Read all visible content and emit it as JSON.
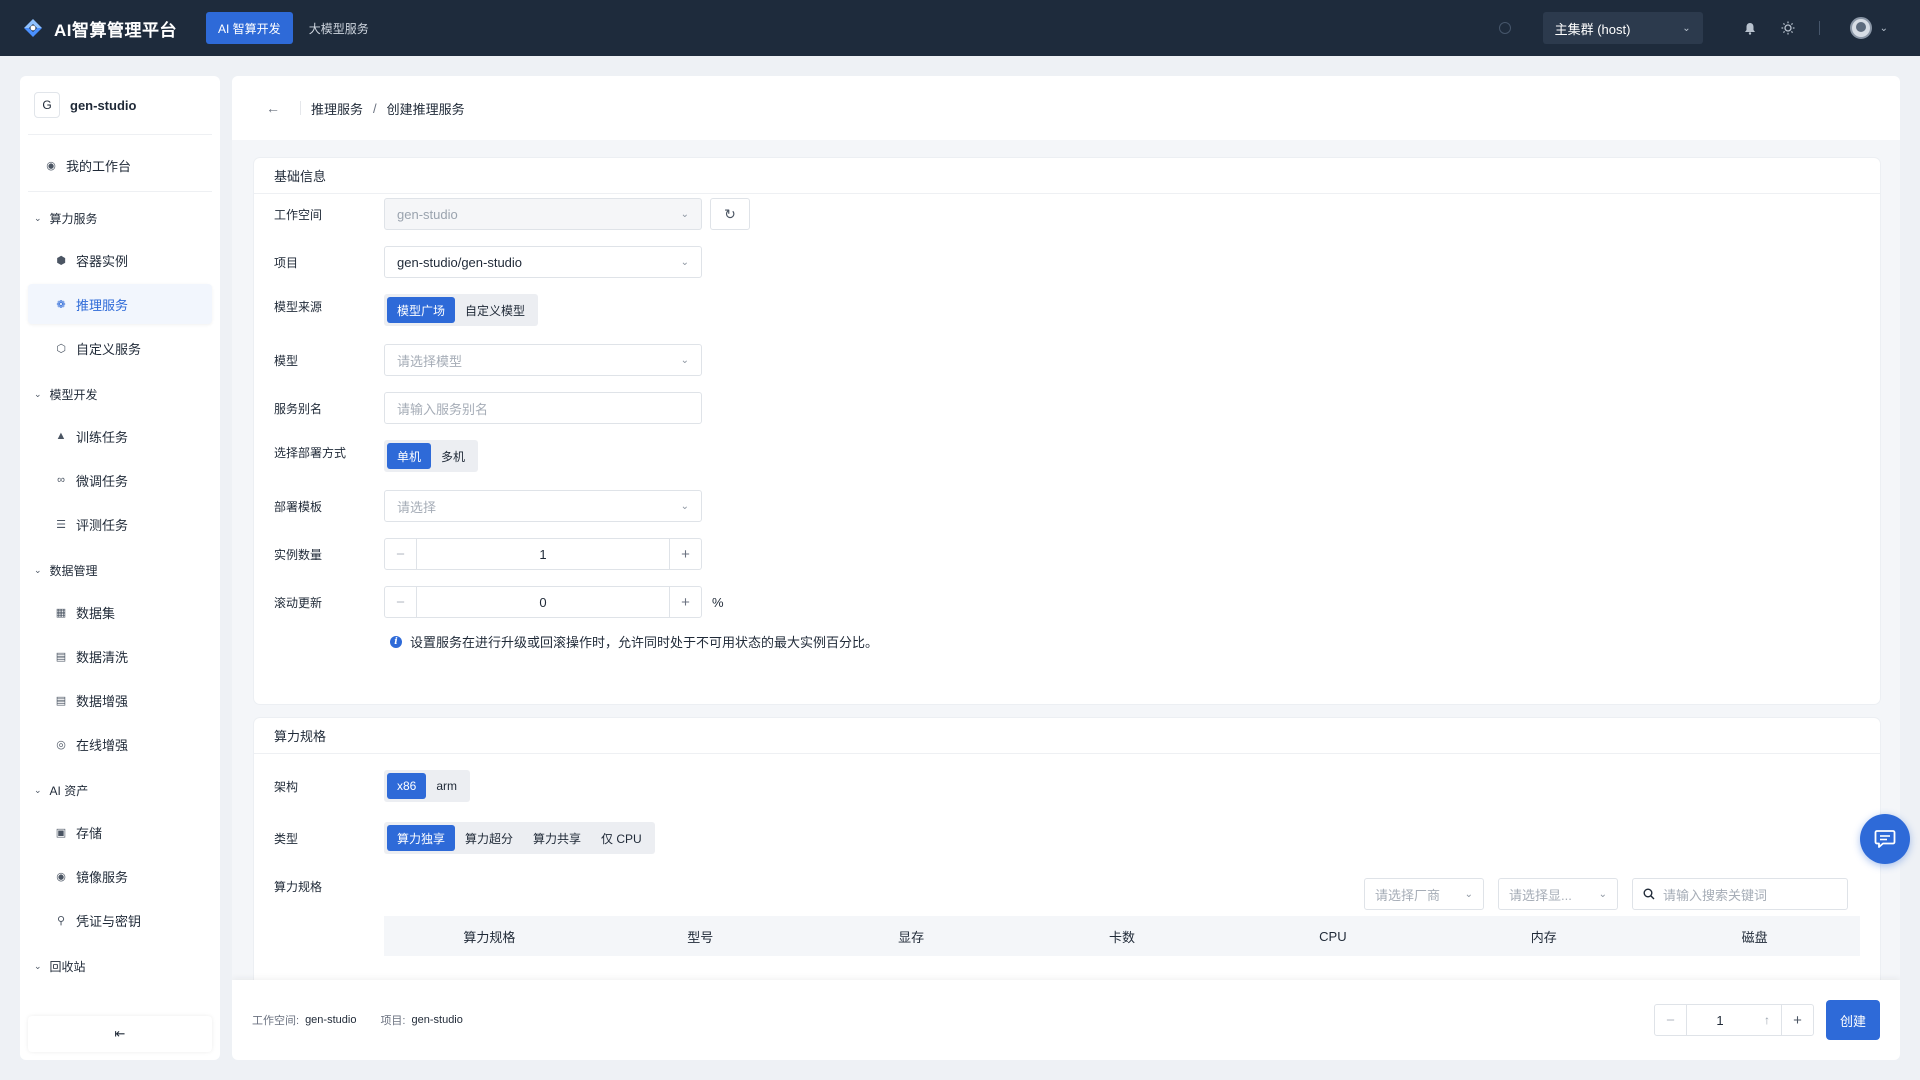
{
  "app": {
    "title": "AI智算管理平台",
    "nav_tabs": [
      {
        "label": "AI 智算开发",
        "active": true
      },
      {
        "label": "大模型服务",
        "active": false
      }
    ],
    "cluster": "主集群 (host)"
  },
  "sidebar": {
    "workspace_badge": "G",
    "workspace_name": "gen-studio",
    "workbench": "我的工作台",
    "groups": [
      {
        "title": "算力服务",
        "items": [
          "容器实例",
          "推理服务",
          "自定义服务"
        ]
      },
      {
        "title": "模型开发",
        "items": [
          "训练任务",
          "微调任务",
          "评测任务"
        ]
      },
      {
        "title": "数据管理",
        "items": [
          "数据集",
          "数据清洗",
          "数据增强",
          "在线增强"
        ]
      },
      {
        "title": "AI 资产",
        "items": [
          "存储",
          "镜像服务",
          "凭证与密钥"
        ]
      },
      {
        "title": "回收站",
        "items": []
      }
    ],
    "active_item": "推理服务",
    "collapse_icon": "⇤"
  },
  "breadcrumb": {
    "parent": "推理服务",
    "sep": "/",
    "current": "创建推理服务"
  },
  "basic": {
    "title": "基础信息",
    "workspace_label": "工作空间",
    "workspace_value": "gen-studio",
    "project_label": "项目",
    "project_value": "gen-studio/gen-studio",
    "source_label": "模型来源",
    "source_options": [
      "模型广场",
      "自定义模型"
    ],
    "model_label": "模型",
    "model_placeholder": "请选择模型",
    "alias_label": "服务别名",
    "alias_placeholder": "请输入服务别名",
    "deploy_label": "选择部署方式",
    "deploy_options": [
      "单机",
      "多机"
    ],
    "template_label": "部署模板",
    "template_placeholder": "请选择",
    "instances_label": "实例数量",
    "instances_value": "1",
    "rolling_label": "滚动更新",
    "rolling_value": "0",
    "rolling_unit": "%",
    "rolling_hint": "设置服务在进行升级或回滚操作时，允许同时处于不可用状态的最大实例百分比。"
  },
  "compute": {
    "title": "算力规格",
    "arch_label": "架构",
    "arch_options": [
      "x86",
      "arm"
    ],
    "type_label": "类型",
    "type_options": [
      "算力独享",
      "算力超分",
      "算力共享",
      "仅 CPU"
    ],
    "spec_label": "算力规格",
    "vendor_placeholder": "请选择厂商",
    "memory_placeholder": "请选择显...",
    "search_placeholder": "请输入搜索关键词",
    "columns": [
      "算力规格",
      "型号",
      "显存",
      "卡数",
      "CPU",
      "内存",
      "磁盘"
    ]
  },
  "footer": {
    "workspace_label": "工作空间:",
    "workspace_value": "gen-studio",
    "project_label": "项目:",
    "project_value": "gen-studio",
    "quantity": "1",
    "create_label": "创建"
  },
  "colors": {
    "topbar": "#1e2b3c",
    "accent": "#2e6ad8"
  }
}
